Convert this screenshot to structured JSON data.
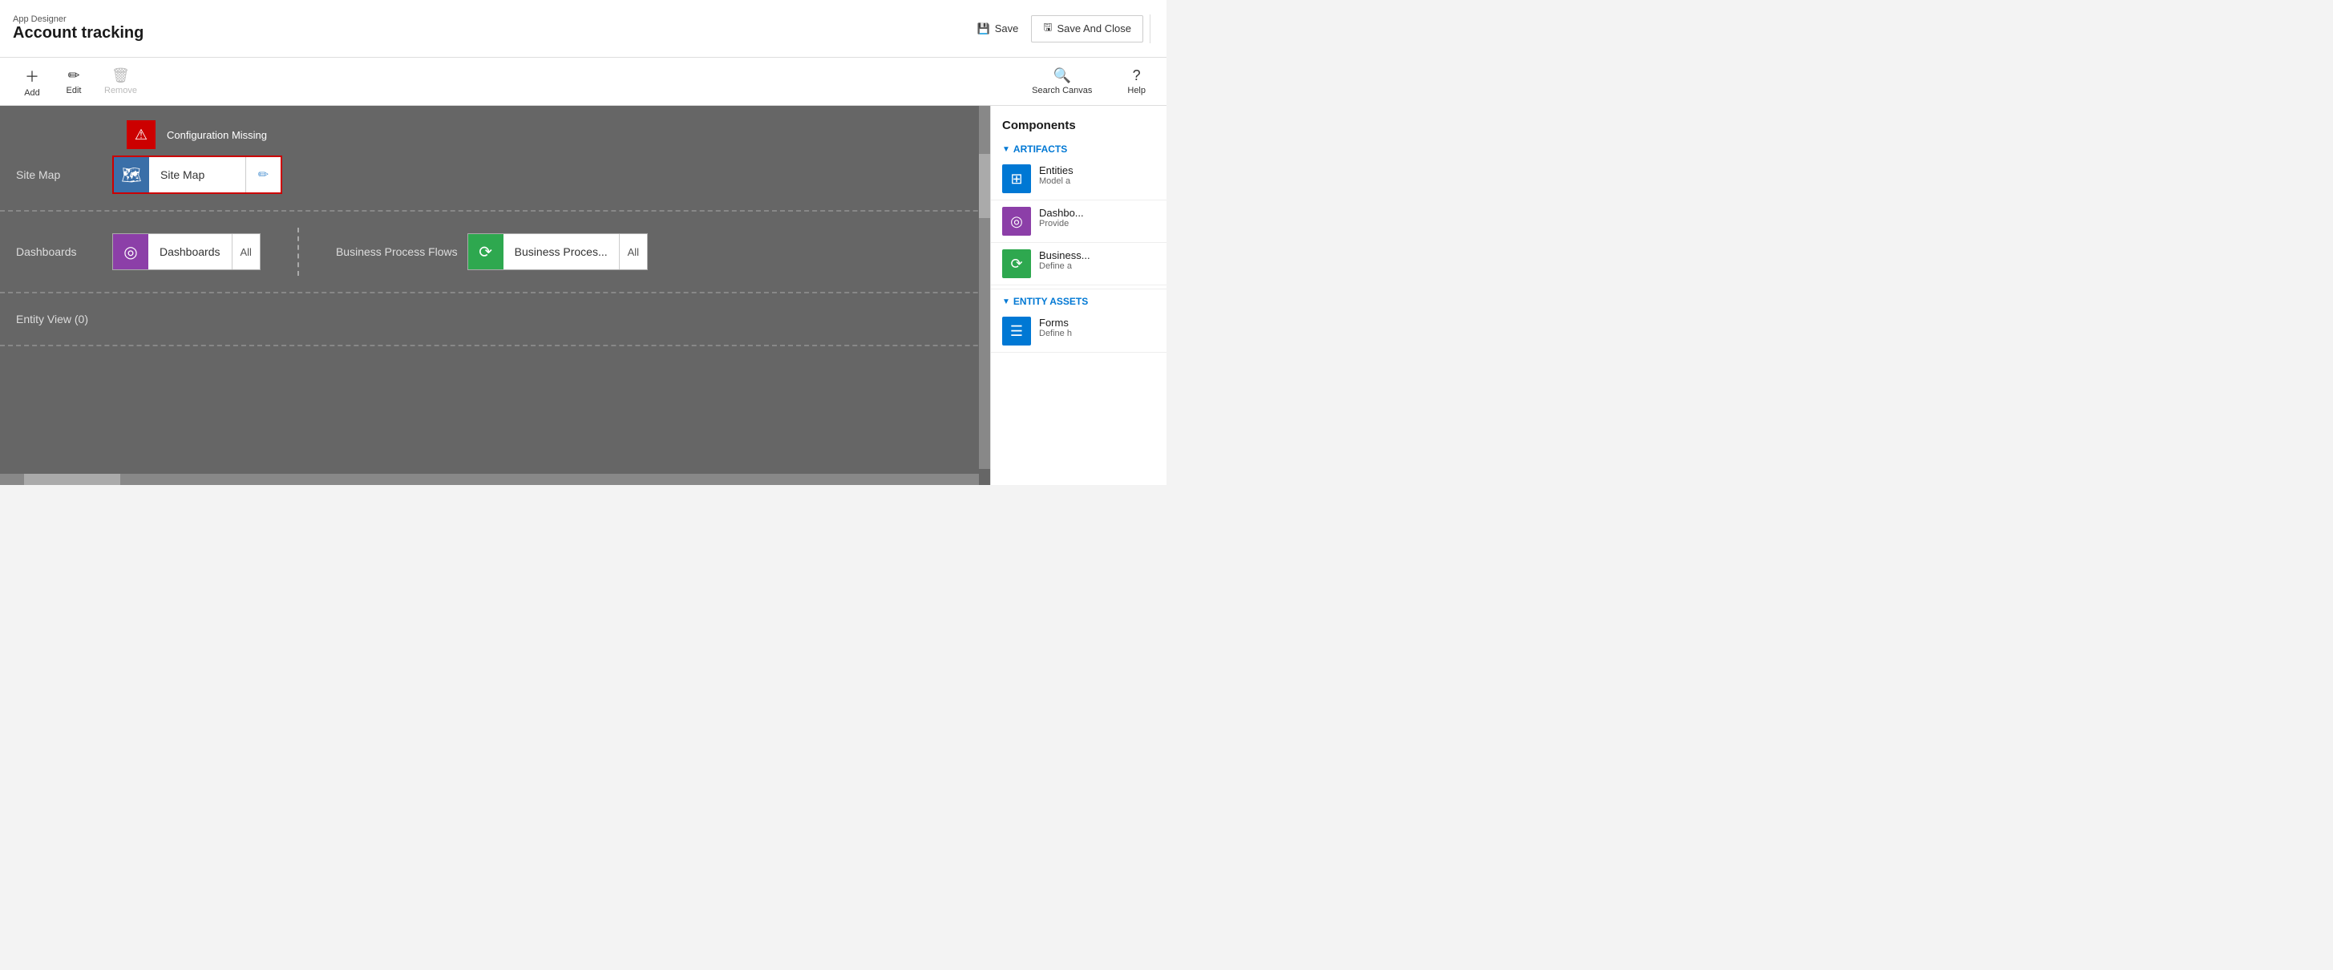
{
  "header": {
    "app_type": "App Designer",
    "title": "Account tracking",
    "save_label": "Save",
    "save_close_label": "Save And Close"
  },
  "toolbar": {
    "add_label": "Add",
    "edit_label": "Edit",
    "remove_label": "Remove",
    "search_canvas_label": "Search Canvas",
    "help_label": "Help"
  },
  "canvas": {
    "site_map_label": "Site Map",
    "config_missing_label": "Configuration Missing",
    "site_map_card_label": "Site Map",
    "dashboards_label": "Dashboards",
    "dashboards_card_label": "Dashboards",
    "dashboards_all": "All",
    "bpf_label": "Business Process Flows",
    "bpf_card_label": "Business Proces...",
    "bpf_all": "All",
    "entity_view_label": "Entity View (0)"
  },
  "components": {
    "title": "Components",
    "artifacts_label": "ARTIFACTS",
    "entity_assets_label": "ENTITY ASSETS",
    "items": [
      {
        "name": "Entities",
        "desc": "Model a",
        "color": "blue",
        "icon": "⊞"
      },
      {
        "name": "Dashbo...",
        "desc": "Provide",
        "color": "purple",
        "icon": "◎"
      },
      {
        "name": "Business...",
        "desc": "Define a",
        "color": "green",
        "icon": "⟳"
      },
      {
        "name": "Forms",
        "desc": "Define h",
        "color": "blue",
        "icon": "☰"
      }
    ]
  }
}
